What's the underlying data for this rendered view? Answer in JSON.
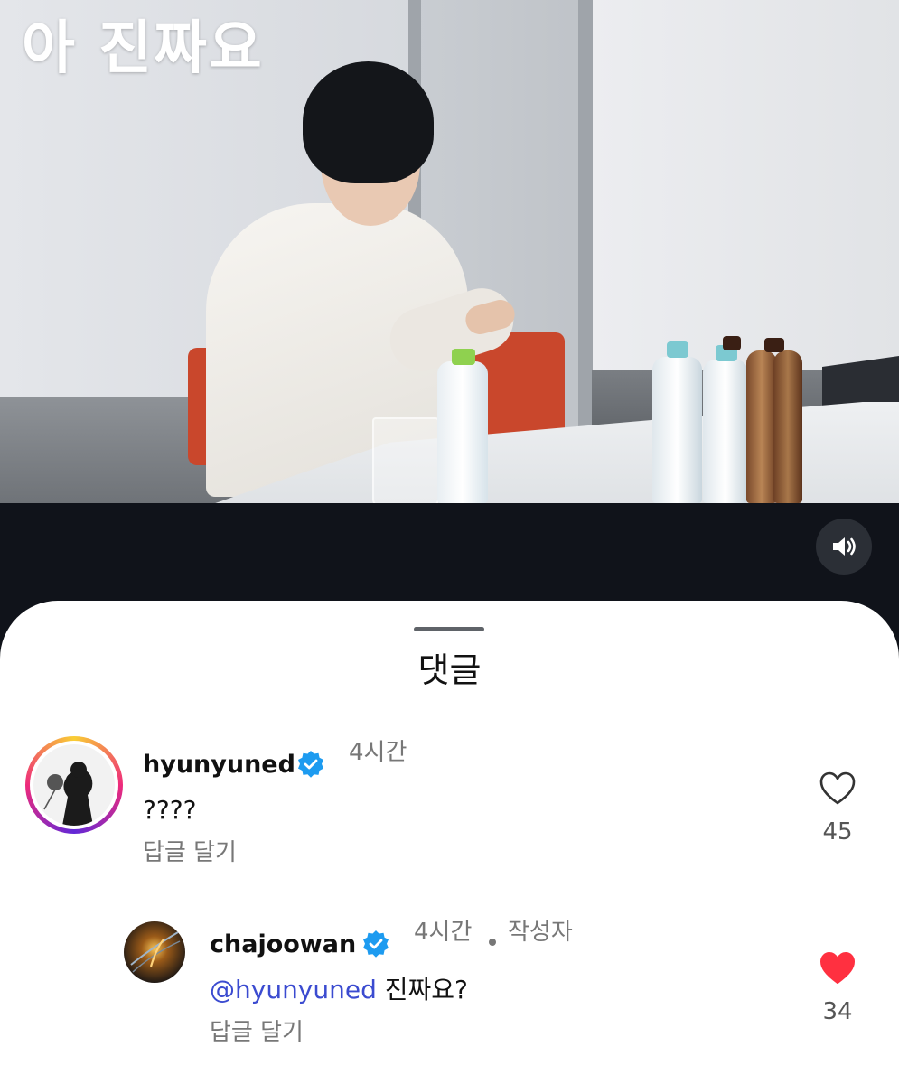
{
  "video": {
    "caption": "아 진짜요"
  },
  "controls": {
    "sound_icon": "speaker-volume-icon"
  },
  "comments_sheet": {
    "title": "댓글",
    "comments": [
      {
        "username": "hyunyuned",
        "verified": true,
        "time": "4시간",
        "text": "????",
        "reply_label": "답글 달기",
        "likes": "45",
        "liked": false
      },
      {
        "username": "chajoowan",
        "verified": true,
        "time": "4시간",
        "author_tag": "작성자",
        "mention": "@hyunyuned",
        "text": " 진짜요?",
        "reply_label": "답글 달기",
        "likes": "34",
        "liked": true
      }
    ]
  },
  "colors": {
    "verified_blue": "#1d9bf0",
    "like_red": "#ff3040",
    "mention": "#3b4bd0",
    "background_dark": "#10131a"
  }
}
